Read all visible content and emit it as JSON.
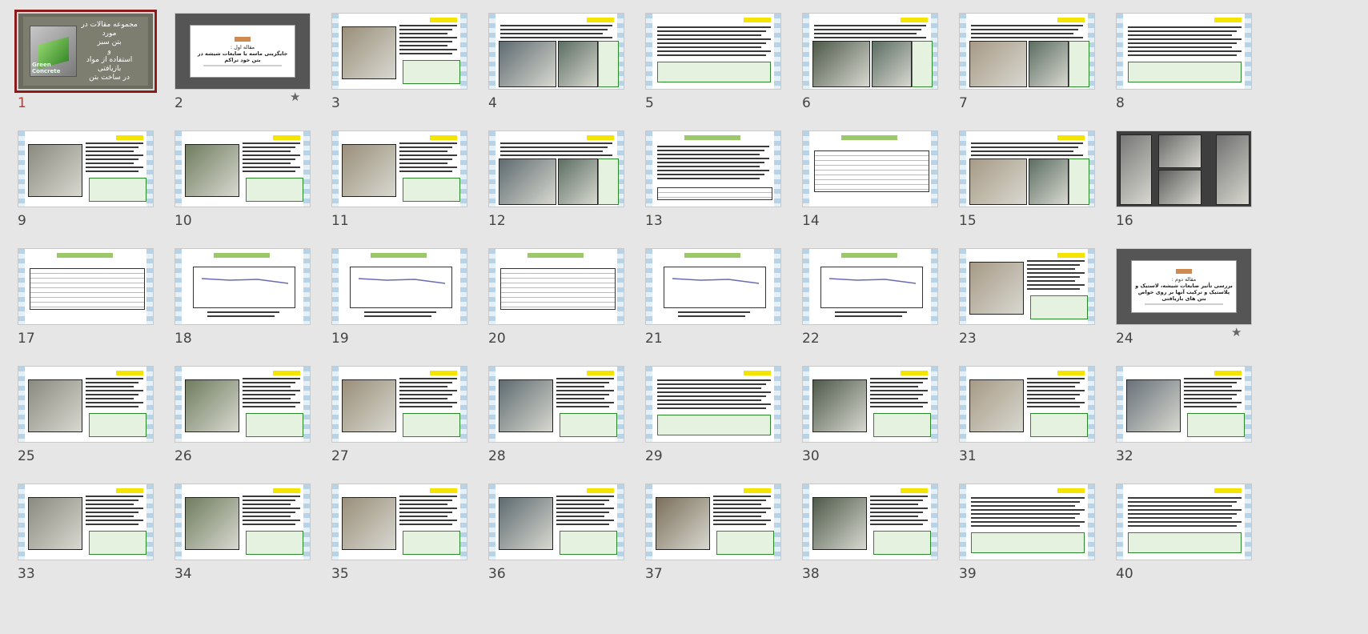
{
  "title_slide": {
    "lines": [
      "مجموعه مقالات در مورد",
      "بتن سبز",
      "و",
      "استفاده از مواد بازیافتی",
      "در ساخت بتن"
    ],
    "logo_text": "Green Concrete"
  },
  "section_slide_2": {
    "label": "مقاله اول :",
    "title": "جایگزینی ماسه با ضایعات شیشه در بتن خود تراکم"
  },
  "section_slide_24": {
    "label": "مقاله دوم :",
    "title": "بررسی تأثیر ضایعات شیشه، لاستیک و پلاستیک و ترکیب آنها بر روی خواص بتن های بازیافتی"
  },
  "active_slide": 1,
  "slides": [
    {
      "n": "1",
      "kind": "title",
      "starred": false
    },
    {
      "n": "2",
      "kind": "section",
      "starred": true
    },
    {
      "n": "3",
      "kind": "pic-left",
      "starred": false
    },
    {
      "n": "4",
      "kind": "two-pics",
      "starred": false
    },
    {
      "n": "5",
      "kind": "text",
      "starred": false
    },
    {
      "n": "6",
      "kind": "two-pics",
      "starred": false
    },
    {
      "n": "7",
      "kind": "two-pics",
      "starred": false
    },
    {
      "n": "8",
      "kind": "text",
      "starred": false
    },
    {
      "n": "9",
      "kind": "pic-left",
      "starred": false
    },
    {
      "n": "10",
      "kind": "pic-left",
      "starred": false
    },
    {
      "n": "11",
      "kind": "pic-left",
      "starred": false
    },
    {
      "n": "12",
      "kind": "two-pics",
      "starred": false
    },
    {
      "n": "13",
      "kind": "text-table",
      "starred": false
    },
    {
      "n": "14",
      "kind": "table",
      "starred": false
    },
    {
      "n": "15",
      "kind": "two-pics",
      "starred": false
    },
    {
      "n": "16",
      "kind": "photos",
      "starred": false
    },
    {
      "n": "17",
      "kind": "table",
      "starred": false
    },
    {
      "n": "18",
      "kind": "chart",
      "starred": false
    },
    {
      "n": "19",
      "kind": "chart",
      "starred": false
    },
    {
      "n": "20",
      "kind": "table",
      "starred": false
    },
    {
      "n": "21",
      "kind": "chart",
      "starred": false
    },
    {
      "n": "22",
      "kind": "chart",
      "starred": false
    },
    {
      "n": "23",
      "kind": "pic-left",
      "starred": false
    },
    {
      "n": "24",
      "kind": "section",
      "starred": true
    },
    {
      "n": "25",
      "kind": "pic-left",
      "starred": false
    },
    {
      "n": "26",
      "kind": "pic-left",
      "starred": false
    },
    {
      "n": "27",
      "kind": "pic-left",
      "starred": false
    },
    {
      "n": "28",
      "kind": "pic-left",
      "starred": false
    },
    {
      "n": "29",
      "kind": "text",
      "starred": false
    },
    {
      "n": "30",
      "kind": "pic-left",
      "starred": false
    },
    {
      "n": "31",
      "kind": "pic-left",
      "starred": false
    },
    {
      "n": "32",
      "kind": "pic-left",
      "starred": false
    },
    {
      "n": "33",
      "kind": "pic-left",
      "starred": false
    },
    {
      "n": "34",
      "kind": "pic-left",
      "starred": false
    },
    {
      "n": "35",
      "kind": "pic-left",
      "starred": false
    },
    {
      "n": "36",
      "kind": "pic-left",
      "starred": false
    },
    {
      "n": "37",
      "kind": "pic-left",
      "starred": false
    },
    {
      "n": "38",
      "kind": "pic-left",
      "starred": false
    },
    {
      "n": "39",
      "kind": "text",
      "starred": false
    },
    {
      "n": "40",
      "kind": "text",
      "starred": false
    }
  ],
  "star_glyph": "★",
  "colors": {
    "background": "#e6e6e6",
    "selected_border": "#8b1a1a",
    "active_number": "#c0392b",
    "header_yellow": "#f5e400",
    "header_green": "#9bc96a"
  }
}
